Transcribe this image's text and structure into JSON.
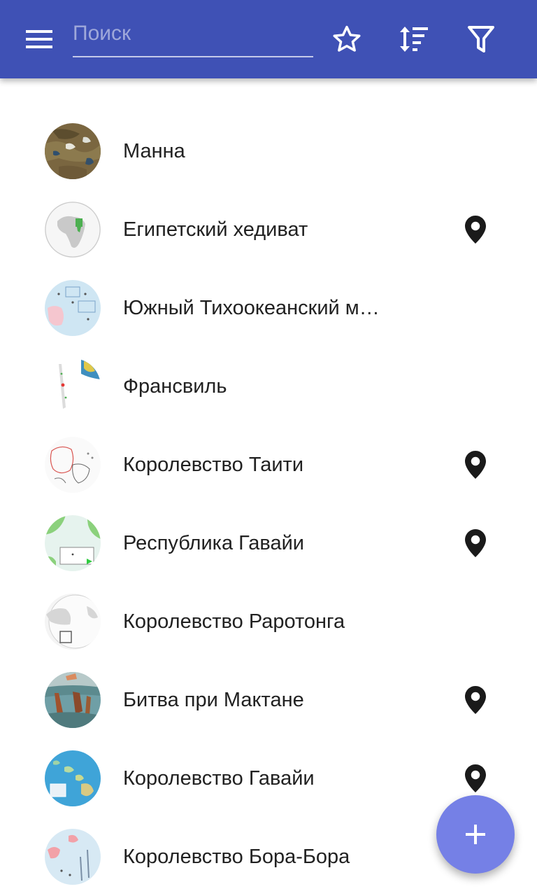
{
  "appbar": {
    "menu_icon": "menu-icon",
    "search": {
      "placeholder": "Поиск",
      "value": ""
    },
    "actions": [
      {
        "name": "favorites",
        "icon": "star-outline-icon"
      },
      {
        "name": "sort",
        "icon": "sort-icon"
      },
      {
        "name": "filter",
        "icon": "filter-icon"
      }
    ],
    "color": "#3f51b5"
  },
  "list": {
    "items": [
      {
        "label": "Манна",
        "has_location": false,
        "thumb": "satellite"
      },
      {
        "label": "Египетский хедиват",
        "has_location": true,
        "thumb": "globe"
      },
      {
        "label": "Южный Тихоокеанский м…",
        "has_location": false,
        "thumb": "pacific-map"
      },
      {
        "label": "Франсвиль",
        "has_location": false,
        "thumb": "island-map"
      },
      {
        "label": "Королевство Таити",
        "has_location": true,
        "thumb": "outline-map"
      },
      {
        "label": "Республика Гавайи",
        "has_location": true,
        "thumb": "green-map"
      },
      {
        "label": "Королевство Раротонга",
        "has_location": false,
        "thumb": "grey-globe"
      },
      {
        "label": "Битва при Мактане",
        "has_location": true,
        "thumb": "painting"
      },
      {
        "label": "Королевство Гавайи",
        "has_location": true,
        "thumb": "blue-map"
      },
      {
        "label": "Королевство Бора-Бора",
        "has_location": false,
        "thumb": "light-map"
      }
    ]
  },
  "fab": {
    "icon": "plus-icon",
    "color": "#7580e6"
  }
}
